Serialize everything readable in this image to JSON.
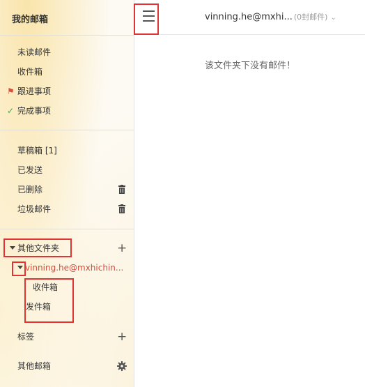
{
  "sidebar": {
    "title": "我的邮箱",
    "group1": [
      {
        "label": "未读邮件"
      },
      {
        "label": "收件箱"
      },
      {
        "label": "跟进事项"
      },
      {
        "label": "完成事项"
      }
    ],
    "group2": [
      {
        "label": "草稿箱 [1]"
      },
      {
        "label": "已发送"
      },
      {
        "label": "已删除"
      },
      {
        "label": "垃圾邮件"
      }
    ],
    "other_folders": {
      "label": "其他文件夹",
      "account": "vinning.he@mxhichin...",
      "subfolders": [
        {
          "label": "收件箱"
        },
        {
          "label": "发件箱"
        }
      ]
    },
    "tags_label": "标签",
    "other_mailboxes_label": "其他邮箱"
  },
  "header": {
    "account": "vinning.he@mxhi...",
    "count": "(0封邮件)"
  },
  "main": {
    "empty_message": "该文件夹下没有邮件！"
  },
  "icons": {
    "menu": "hamburger-menu-icon",
    "flag": "flag-icon",
    "check": "check-icon",
    "trash": "trash-icon",
    "plus": "plus-icon",
    "gear": "gear-icon",
    "caret": "caret-down-icon",
    "chevron": "chevron-down-icon"
  },
  "colors": {
    "annotation": "#e03434",
    "account_text": "#d64b3c",
    "flag": "#d94d3b",
    "check": "#4aa34a"
  }
}
